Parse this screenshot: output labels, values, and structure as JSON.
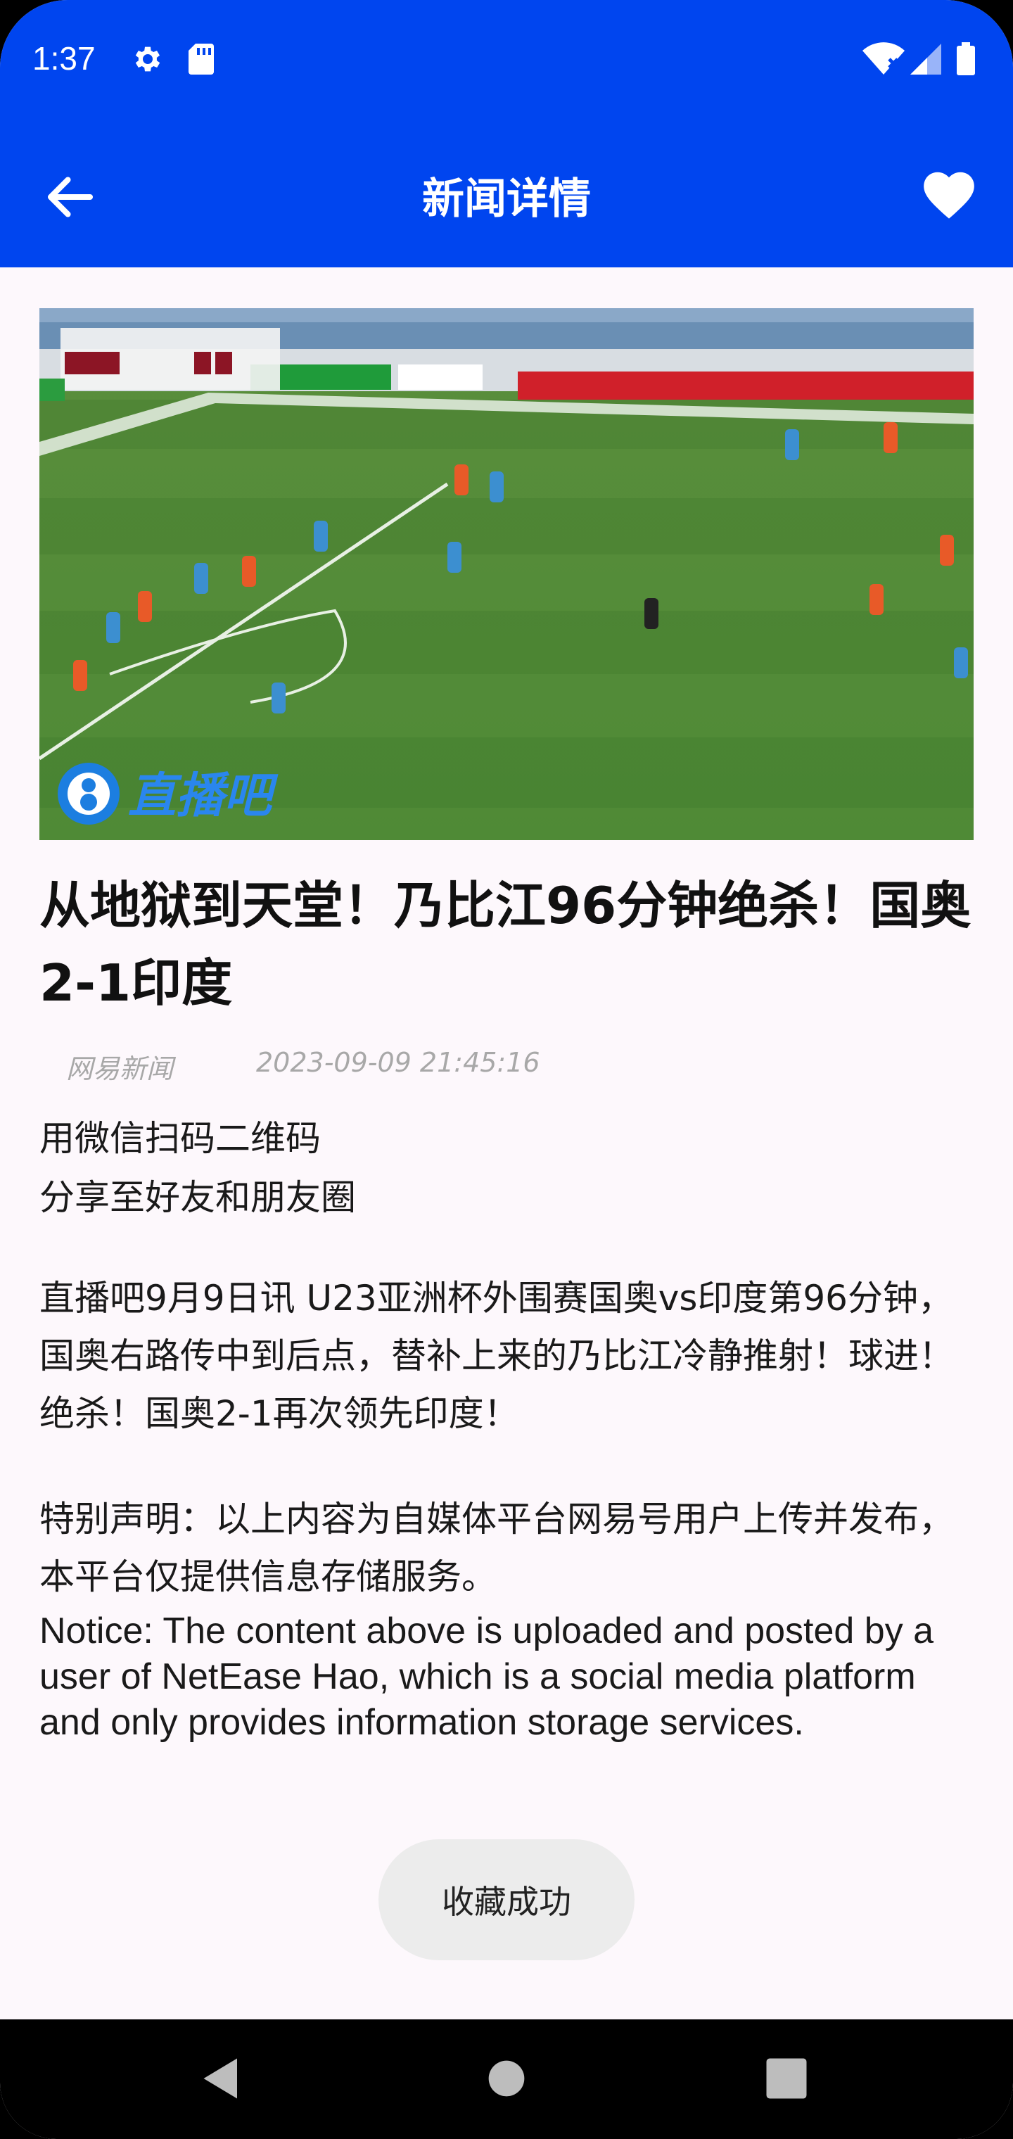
{
  "status_bar": {
    "time": "1:37"
  },
  "app_bar": {
    "title": "新闻详情"
  },
  "hero_image": {
    "watermark": "直播吧"
  },
  "article": {
    "title": "从地狱到天堂！乃比江96分钟绝杀！国奥2-1印度",
    "source": "网易新闻",
    "datetime": "2023-09-09 21:45:16",
    "share_line1": "用微信扫码二维码",
    "share_line2": "分享至好友和朋友圈",
    "paragraph": "直播吧9月9日讯 U23亚洲杯外围赛国奥vs印度第96分钟，国奥右路传中到后点，替补上来的乃比江冷静推射！球进！绝杀！国奥2-1再次领先印度！",
    "statement": "特别声明：以上内容为自媒体平台网易号用户上传并发布，本平台仅提供信息存储服务。",
    "notice": "Notice: The content above  is uploaded and posted by a user of NetEase Hao, which is a social media platform and only provides information storage services."
  },
  "toast": {
    "message": "收藏成功"
  },
  "colors": {
    "primary": "#0045ef",
    "background": "#fdf8fc",
    "meta_text": "#a8a8a8"
  },
  "icons": {
    "back": "arrow-left-icon",
    "favorite": "heart-icon",
    "settings": "gear-icon",
    "sd_card": "sd-card-icon",
    "wifi": "wifi-icon",
    "signal": "signal-icon",
    "battery": "battery-icon"
  }
}
